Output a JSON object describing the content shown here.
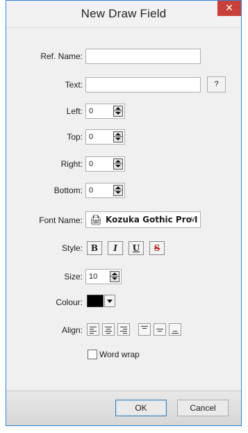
{
  "dialog": {
    "title": "New Draw Field",
    "close_glyph": "✕"
  },
  "fields": {
    "ref_name": {
      "label": "Ref. Name:",
      "value": ""
    },
    "text": {
      "label": "Text:",
      "value": "",
      "help_label": "?"
    },
    "left": {
      "label": "Left:",
      "value": "0"
    },
    "top": {
      "label": "Top:",
      "value": "0"
    },
    "right": {
      "label": "Right:",
      "value": "0"
    },
    "bottom": {
      "label": "Bottom:",
      "value": "0"
    }
  },
  "font": {
    "label": "Font Name:",
    "value": "Kozuka Gothic Pro I",
    "icon": "printer-font-icon",
    "icon_glyph": "🖨",
    "chevron": "∨"
  },
  "style": {
    "label": "Style:",
    "buttons": [
      {
        "name": "bold",
        "label": "B"
      },
      {
        "name": "italic",
        "label": "I"
      },
      {
        "name": "underline",
        "label": "U"
      },
      {
        "name": "strikethrough",
        "label": "S"
      }
    ]
  },
  "size": {
    "label": "Size:",
    "value": "10"
  },
  "colour": {
    "label": "Colour:",
    "value": "#000000"
  },
  "align": {
    "label": "Align:",
    "horizontal": [
      "align-left",
      "align-center",
      "align-right"
    ],
    "vertical": [
      "align-top",
      "align-middle",
      "align-bottom"
    ]
  },
  "word_wrap": {
    "label": "Word wrap",
    "checked": false
  },
  "footer": {
    "ok_label": "OK",
    "cancel_label": "Cancel"
  }
}
